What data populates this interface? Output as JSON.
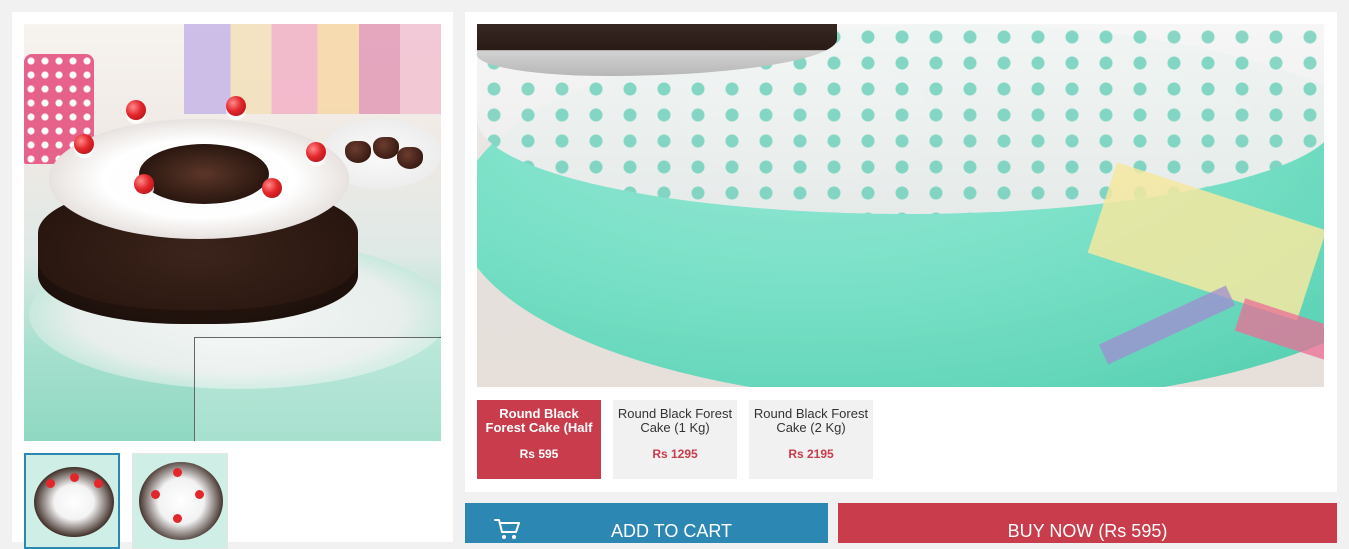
{
  "product": {
    "variants": [
      {
        "name": "Round Black Forest Cake (Half Kg)",
        "price": "Rs 595",
        "selected": true
      },
      {
        "name": "Round Black Forest Cake (1 Kg)",
        "price": "Rs 1295",
        "selected": false
      },
      {
        "name": "Round Black Forest Cake (2 Kg)",
        "price": "Rs 2195",
        "selected": false
      }
    ]
  },
  "actions": {
    "add_to_cart": "ADD TO CART",
    "buy_now": "BUY NOW (Rs 595)"
  },
  "colors": {
    "accent_blue": "#2d87b3",
    "accent_red": "#c83c4b",
    "page_bg": "#f1f1f1"
  },
  "icons": {
    "cart": "cart-icon"
  }
}
